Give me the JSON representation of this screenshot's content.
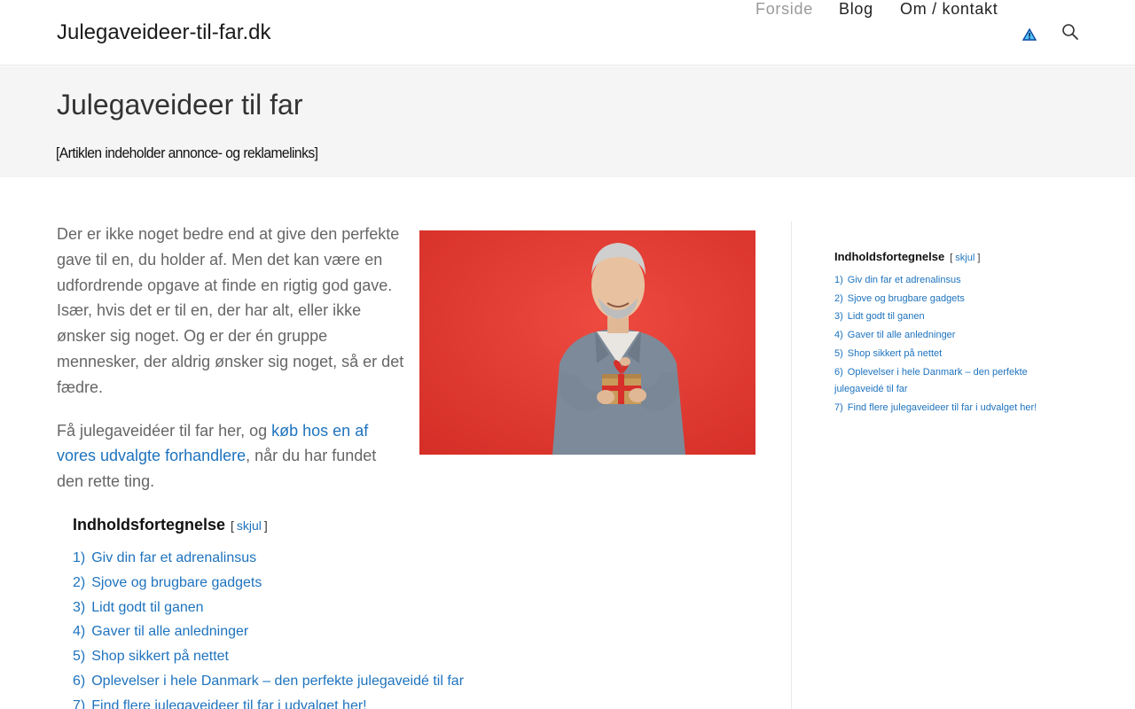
{
  "header": {
    "site_title": "Julegaveideer-til-far.dk",
    "nav": [
      {
        "label": "Forside",
        "active": true
      },
      {
        "label": "Blog",
        "active": false
      },
      {
        "label": "Om / kontakt",
        "active": false
      }
    ],
    "icons": [
      "warning-icon",
      "search-icon"
    ]
  },
  "page": {
    "title": "Julegaveideer til far",
    "disclaimer": "[Artiklen indeholder annonce- og reklamelinks]"
  },
  "intro": {
    "paragraph1": "Der er ikke noget bedre end at give den perfekte gave til en, du holder af. Men det kan være en udfordrende opgave at finde en rigtig god gave. Især, hvis det er til en, der har alt, eller ikke ønsker sig noget. Og er der én gruppe mennesker, der aldrig ønsker sig noget, så er det fædre.",
    "paragraph2_prefix": "Få julegaveidéer til far her, og ",
    "paragraph2_link": "køb hos en af vores udvalgte forhandlere",
    "paragraph2_suffix": ", når du har fundet den rette ting."
  },
  "toc": {
    "heading": "Indholdsfortegnelse",
    "toggle_open": "[",
    "toggle_label": "skjul",
    "toggle_close": "]",
    "items": [
      {
        "num": "1)",
        "label": "Giv din far et adrenalinsus"
      },
      {
        "num": "2)",
        "label": "Sjove og brugbare gadgets"
      },
      {
        "num": "3)",
        "label": "Lidt godt til ganen"
      },
      {
        "num": "4)",
        "label": "Gaver til alle anledninger"
      },
      {
        "num": "5)",
        "label": "Shop sikkert på nettet"
      },
      {
        "num": "6)",
        "label": "Oplevelser i hele Danmark – den perfekte julegaveidé til far"
      },
      {
        "num": "7)",
        "label": "Find flere julegaveideer til far i udvalget her!"
      }
    ]
  },
  "colors": {
    "link": "#1e73be",
    "hero_background": "#e23a32",
    "title_band": "#f5f5f5"
  }
}
